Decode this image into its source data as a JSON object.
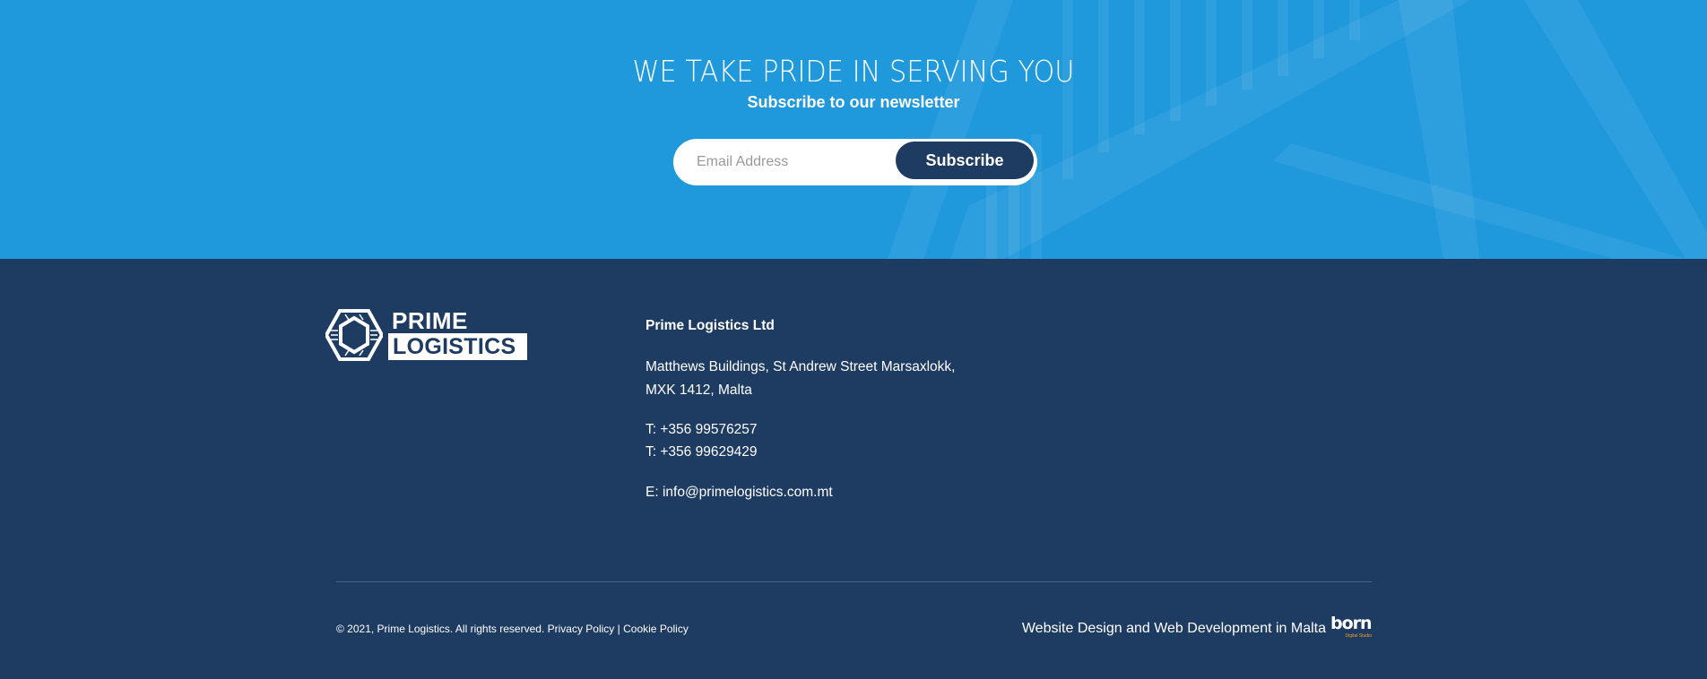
{
  "newsletter": {
    "heading": "WE TAKE PRIDE IN SERVING YOU",
    "subheading": "Subscribe to our newsletter",
    "email_placeholder": "Email Address",
    "subscribe_label": "Subscribe"
  },
  "footer": {
    "logo_top": "PRIME",
    "logo_bottom": "LOGISTICS",
    "company": "Prime Logistics Ltd",
    "address_line1": "Matthews Buildings, St Andrew Street Marsaxlokk,",
    "address_line2": "MXK 1412, Malta",
    "phone1": "T: +356 99576257",
    "phone2": "T: +356 99629429",
    "email": "E: info@primelogistics.com.mt",
    "copyright": "© 2021, Prime Logistics. All rights reserved.",
    "privacy_label": "Privacy Policy",
    "separator": "|",
    "cookie_label": "Cookie Policy",
    "credit_text": "Website Design and Web Development in Malta",
    "credit_logo": "born",
    "credit_logo_tagline": "Digital Studio"
  },
  "colors": {
    "newsletter_bg": "#1f98dc",
    "footer_bg": "#1e3b62",
    "button_bg": "#1e3b62",
    "accent_orange": "#f0a22a"
  }
}
